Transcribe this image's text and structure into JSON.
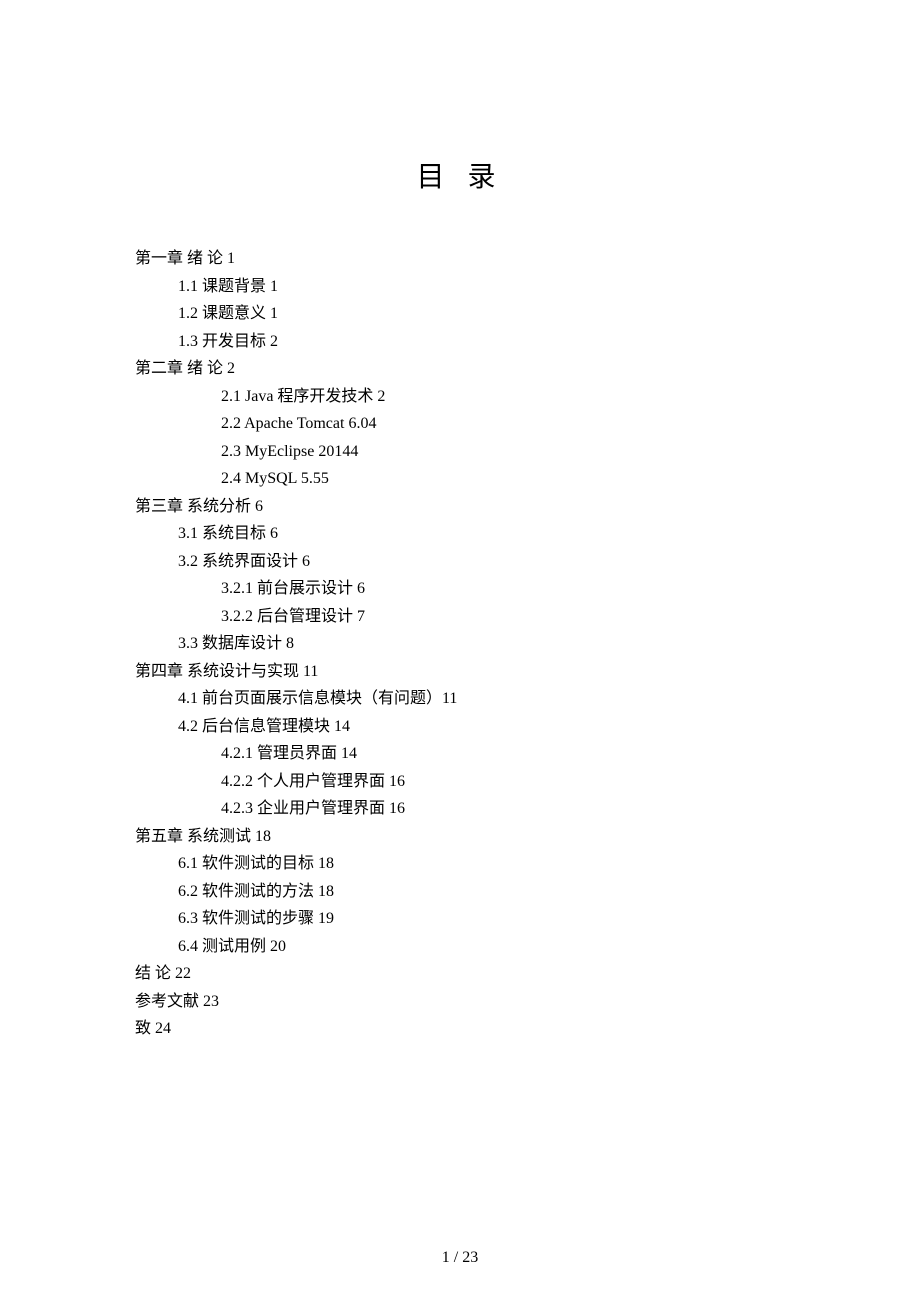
{
  "title": "目 录",
  "entries": [
    {
      "level": 0,
      "text": "第一章 绪 论 1"
    },
    {
      "level": 1,
      "text": "1.1 课题背景 1"
    },
    {
      "level": 1,
      "text": "1.2 课题意义 1"
    },
    {
      "level": 1,
      "text": "1.3 开发目标 2"
    },
    {
      "level": 0,
      "text": "第二章 绪 论 2"
    },
    {
      "level": 2,
      "text": "2.1 Java 程序开发技术 2"
    },
    {
      "level": 2,
      "text": "2.2 Apache Tomcat 6.04"
    },
    {
      "level": 2,
      "text": "2.3 MyEclipse 20144"
    },
    {
      "level": 2,
      "text": "2.4 MySQL 5.55"
    },
    {
      "level": 0,
      "text": "第三章 系统分析 6"
    },
    {
      "level": 1,
      "text": "3.1 系统目标 6"
    },
    {
      "level": 1,
      "text": "3.2 系统界面设计 6"
    },
    {
      "level": 2,
      "text": "3.2.1 前台展示设计 6"
    },
    {
      "level": 2,
      "text": "3.2.2 后台管理设计 7"
    },
    {
      "level": 1,
      "text": "3.3 数据库设计 8"
    },
    {
      "level": 0,
      "text": "第四章 系统设计与实现 11"
    },
    {
      "level": 1,
      "text": "4.1 前台页面展示信息模块（有问题）11"
    },
    {
      "level": 1,
      "text": "4.2 后台信息管理模块 14"
    },
    {
      "level": 2,
      "text": "4.2.1 管理员界面 14"
    },
    {
      "level": 2,
      "text": "4.2.2 个人用户管理界面 16"
    },
    {
      "level": 2,
      "text": "4.2.3 企业用户管理界面 16"
    },
    {
      "level": 0,
      "text": "第五章 系统测试 18"
    },
    {
      "level": 1,
      "text": "6.1 软件测试的目标 18"
    },
    {
      "level": 1,
      "text": "6.2 软件测试的方法 18"
    },
    {
      "level": 1,
      "text": "6.3 软件测试的步骤 19"
    },
    {
      "level": 1,
      "text": "6.4 测试用例 20"
    },
    {
      "level": 0,
      "text": "结 论 22"
    },
    {
      "level": 0,
      "text": "参考文献 23"
    },
    {
      "level": 0,
      "text": "致 24"
    }
  ],
  "footer": "1 / 23"
}
